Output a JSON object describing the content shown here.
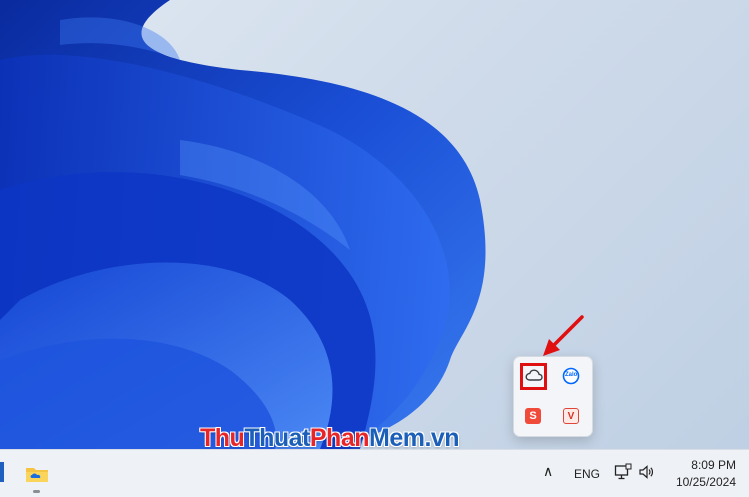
{
  "watermark": {
    "part1": "Thu",
    "part2": "Thuat",
    "part3": "Phan",
    "part4": "Mem.vn"
  },
  "tray_overflow": {
    "icons": [
      {
        "name": "onedrive-cloud-icon",
        "highlighted": true
      },
      {
        "name": "zalo-icon",
        "label": "Zalo"
      },
      {
        "name": "s-app-icon",
        "label": "S"
      },
      {
        "name": "v-app-icon",
        "label": "V"
      }
    ]
  },
  "taskbar": {
    "chevron": "∧",
    "language": "ENG",
    "time": "8:09 PM",
    "date": "10/25/2024"
  },
  "colors": {
    "highlight_box": "#e01010",
    "arrow": "#e01010",
    "wallpaper_blue": "#1a4fd0"
  }
}
